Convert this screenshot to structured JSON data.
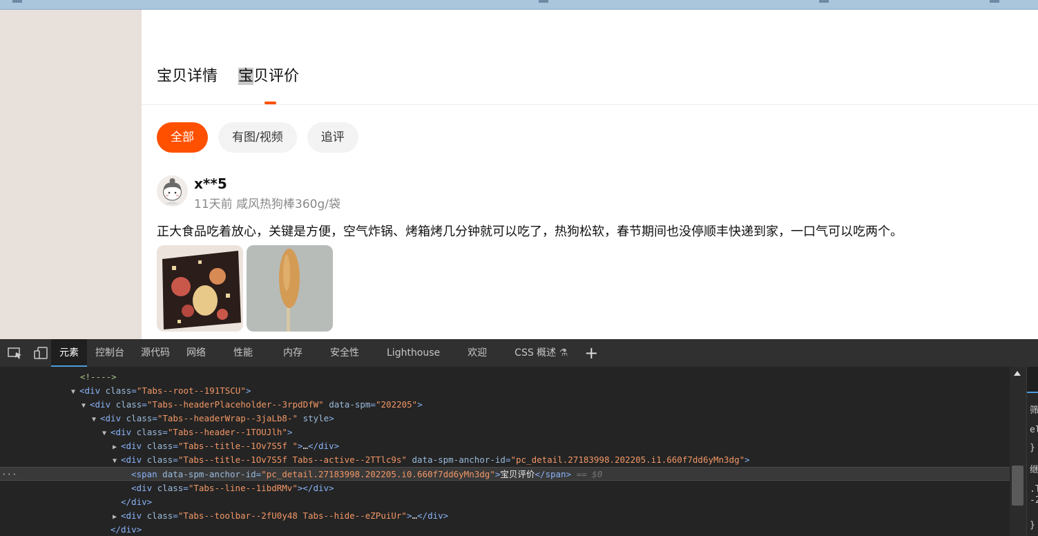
{
  "page": {
    "tabs": [
      {
        "label": "宝贝详情",
        "active": false
      },
      {
        "label_first": "宝",
        "label_rest": "贝评价",
        "active": true
      }
    ],
    "filters": [
      {
        "label": "全部",
        "active": true
      },
      {
        "label": "有图/视频",
        "active": false
      },
      {
        "label": "追评",
        "active": false
      }
    ],
    "review": {
      "username": "x**5",
      "meta": "11天前 咸风热狗棒360g/袋",
      "content": "正大食品吃着放心，关键是方便，空气炸锅、烤箱烤几分钟就可以吃了，热狗松软，春节期间也没停顺丰快递到家，一口气可以吃两个。"
    }
  },
  "devtools": {
    "tabs": [
      "元素",
      "控制台",
      "源代码",
      "网络",
      "性能",
      "内存",
      "安全性",
      "Lighthouse",
      "欢迎",
      "CSS 概述"
    ],
    "active_tab": "元素",
    "dom": {
      "comment": "<!---->",
      "l1_tag": "div",
      "l1_attr": "class",
      "l1_val": "Tabs--root--191TSCU",
      "l2_tag": "div",
      "l2_attr": "class",
      "l2_val": "Tabs--headerPlaceholder--3rpdDfW",
      "l2_attr2": "data-spm",
      "l2_val2": "202205",
      "l3_tag": "div",
      "l3_attr": "class",
      "l3_val": "Tabs--headerWrap--3jaLb8-",
      "l3_attr2": "style",
      "l4_tag": "div",
      "l4_attr": "class",
      "l4_val": "Tabs--header--1TOUJlh",
      "l5_tag": "div",
      "l5_attr": "class",
      "l5_val": "Tabs--title--1Ov7S5f ",
      "l6_tag": "div",
      "l6_attr": "class",
      "l6_val": "Tabs--title--1Ov7S5f Tabs--active--2TTlc9s",
      "l6_attr2": "data-spm-anchor-id",
      "l6_val2": "pc_detail.27183998.202205.i1.660f7dd6yMn3dg",
      "l7_tag": "span",
      "l7_attr": "data-spm-anchor-id",
      "l7_val": "pc_detail.27183998.202205.i0.660f7dd6yMn3dg",
      "l7_text": "宝贝评价",
      "l7_eq": "== $0",
      "l8_tag": "div",
      "l8_attr": "class",
      "l8_val": "Tabs--line--1ibdRMv",
      "l9_close": "</div>",
      "l10_tag": "div",
      "l10_attr": "class",
      "l10_val": "Tabs--toolbar--2fU0y48 Tabs--hide--eZPuiUr",
      "l11_close": "</div>",
      "ellipsis": "…",
      "dots": "···"
    },
    "sidepane": [
      "筛",
      "el",
      "}",
      "继",
      ".T",
      "-2",
      "}"
    ]
  }
}
